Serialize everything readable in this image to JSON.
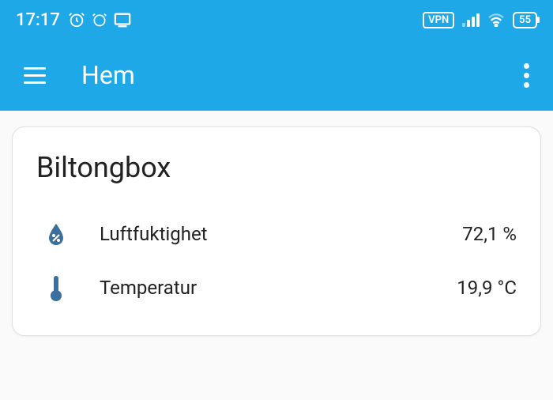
{
  "status": {
    "time": "17:17",
    "vpn_label": "VPN",
    "battery_level": "55"
  },
  "appbar": {
    "title": "Hem"
  },
  "card": {
    "title": "Biltongbox",
    "sensors": {
      "humidity": {
        "label": "Luftfuktighet",
        "value": "72,1 %"
      },
      "temperature": {
        "label": "Temperatur",
        "value": "19,9 °C"
      }
    }
  }
}
